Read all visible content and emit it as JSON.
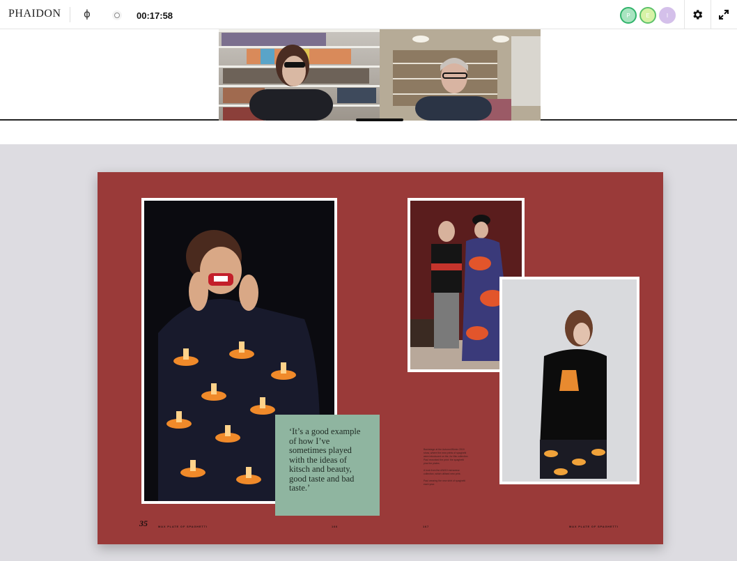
{
  "topbar": {
    "logo": "PHAIDON",
    "phi_symbol": "ɸ",
    "timer": "00:17:58",
    "participants": [
      "P",
      "E",
      "I"
    ],
    "settings_icon": "gear-icon",
    "fullscreen_icon": "expand-icon"
  },
  "book": {
    "quote": "‘It’s a good example of how I’ve sometimes played with the ideas of kitsch and beauty, good taste and bad taste.’",
    "chapter_number": "35",
    "section_title_left": "MAX PLATE OF SPAGHETTI",
    "section_title_right": "MAX PLATE OF SPAGHETTI",
    "page_left": "166",
    "page_right": "167",
    "captions": [
      "Backstage at the Autumn/Winter 2019 show, where the new prints of spaghetti were introduced on the, for this collection Paul reworked the print: the spaghetti plus the plates.",
      "A look from the A/W19 menswear collection, which utilised new print.",
      "Paul wearing the new shirt of spaghetti each year."
    ]
  },
  "colors": {
    "spread_bg": "#9a3a39",
    "quote_bg": "#8fb5a0",
    "stage_bg": "#dddce1"
  }
}
